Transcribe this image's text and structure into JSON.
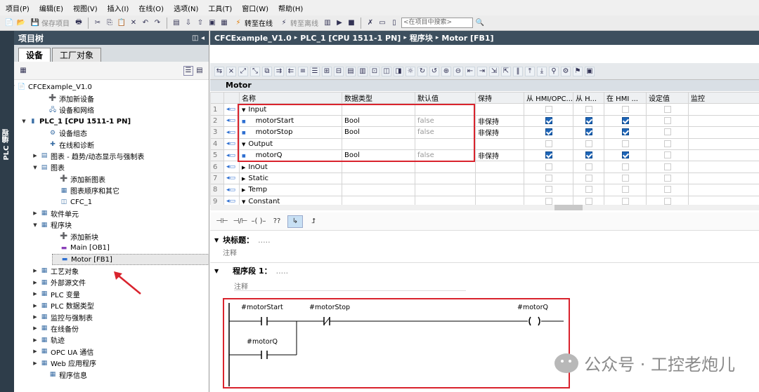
{
  "menu": [
    "项目(P)",
    "编辑(E)",
    "视图(V)",
    "插入(I)",
    "在线(O)",
    "选项(N)",
    "工具(T)",
    "窗口(W)",
    "帮助(H)"
  ],
  "toolbar": {
    "save_label": "保存项目",
    "go_online": "转至在线",
    "go_offline": "转至离线",
    "search_placeholder": "<在项目中搜索>"
  },
  "sidebar_tab": "PLC 编程",
  "project_tree": {
    "title": "项目树",
    "tabs": [
      "设备",
      "工厂对象"
    ],
    "items": [
      {
        "label": "CFCExample_V1.0",
        "icon": "project-icon"
      },
      {
        "label": "添加新设备",
        "icon": "add-device-icon"
      },
      {
        "label": "设备和网络",
        "icon": "network-icon"
      },
      {
        "label": "PLC_1 [CPU 1511-1 PN]",
        "icon": "cpu-icon"
      },
      {
        "label": "设备组态",
        "icon": "device-config-icon"
      },
      {
        "label": "在线和诊断",
        "icon": "diagnostics-icon"
      },
      {
        "label": "图表 - 趋势/动态显示与强制表",
        "icon": "chart-folder-icon"
      },
      {
        "label": "图表",
        "icon": "chart-folder-icon"
      },
      {
        "label": "添加新图表",
        "icon": "add-chart-icon"
      },
      {
        "label": "图表顺序和其它",
        "icon": "chart-order-icon"
      },
      {
        "label": "CFC_1",
        "icon": "cfc-icon"
      },
      {
        "label": "软件单元",
        "icon": "software-unit-icon"
      },
      {
        "label": "程序块",
        "icon": "program-blocks-icon"
      },
      {
        "label": "添加新块",
        "icon": "add-block-icon"
      },
      {
        "label": "Main [OB1]",
        "icon": "ob-icon"
      },
      {
        "label": "Motor [FB1]",
        "icon": "fb-icon"
      },
      {
        "label": "工艺对象",
        "icon": "tech-object-icon"
      },
      {
        "label": "外部源文件",
        "icon": "external-source-icon"
      },
      {
        "label": "PLC 变量",
        "icon": "plc-tags-icon"
      },
      {
        "label": "PLC 数据类型",
        "icon": "plc-datatype-icon"
      },
      {
        "label": "监控与强制表",
        "icon": "watch-table-icon"
      },
      {
        "label": "在线备份",
        "icon": "online-backup-icon"
      },
      {
        "label": "轨迹",
        "icon": "trace-icon"
      },
      {
        "label": "OPC UA 通信",
        "icon": "opcua-icon"
      },
      {
        "label": "Web 应用程序",
        "icon": "web-app-icon"
      },
      {
        "label": "程序信息",
        "icon": "program-info-icon"
      }
    ]
  },
  "editor": {
    "breadcrumb": [
      "CFCExample_V1.0",
      "PLC_1 [CPU 1511-1 PN]",
      "程序块",
      "Motor [FB1]"
    ],
    "block_name": "Motor",
    "columns": [
      "名称",
      "数据类型",
      "默认值",
      "保持",
      "从 HMI/OPC...",
      "从 H...",
      "在 HMI ...",
      "设定值",
      "监控"
    ],
    "rows": [
      {
        "num": "1",
        "name": "Input",
        "type": "",
        "default": "",
        "retain": "",
        "hmi1": null,
        "hmi2": null,
        "hmi3": null
      },
      {
        "num": "2",
        "name": "motorStart",
        "type": "Bool",
        "default": "false",
        "retain": "非保持",
        "hmi1": true,
        "hmi2": true,
        "hmi3": true
      },
      {
        "num": "3",
        "name": "motorStop",
        "type": "Bool",
        "default": "false",
        "retain": "非保持",
        "hmi1": true,
        "hmi2": true,
        "hmi3": true
      },
      {
        "num": "4",
        "name": "Output",
        "type": "",
        "default": "",
        "retain": "",
        "hmi1": null,
        "hmi2": null,
        "hmi3": null
      },
      {
        "num": "5",
        "name": "motorQ",
        "type": "Bool",
        "default": "false",
        "retain": "非保持",
        "hmi1": true,
        "hmi2": true,
        "hmi3": true
      },
      {
        "num": "6",
        "name": "InOut",
        "type": "",
        "default": "",
        "retain": "",
        "hmi1": null,
        "hmi2": null,
        "hmi3": null
      },
      {
        "num": "7",
        "name": "Static",
        "type": "",
        "default": "",
        "retain": "",
        "hmi1": null,
        "hmi2": null,
        "hmi3": null
      },
      {
        "num": "8",
        "name": "Temp",
        "type": "",
        "default": "",
        "retain": "",
        "hmi1": null,
        "hmi2": null,
        "hmi3": null
      },
      {
        "num": "9",
        "name": "Constant",
        "type": "",
        "default": "",
        "retain": "",
        "hmi1": null,
        "hmi2": null,
        "hmi3": null
      }
    ],
    "block_title_label": "块标题：",
    "block_title_dots": ".....",
    "comment_label": "注释",
    "network_label": "程序段 1：",
    "network_dots": ".....",
    "network_comment": "注释",
    "operands": {
      "start": "#motorStart",
      "stop": "#motorStop",
      "coil": "#motorQ",
      "seal": "#motorQ"
    }
  },
  "watermark": "公众号 · 工控老炮儿"
}
